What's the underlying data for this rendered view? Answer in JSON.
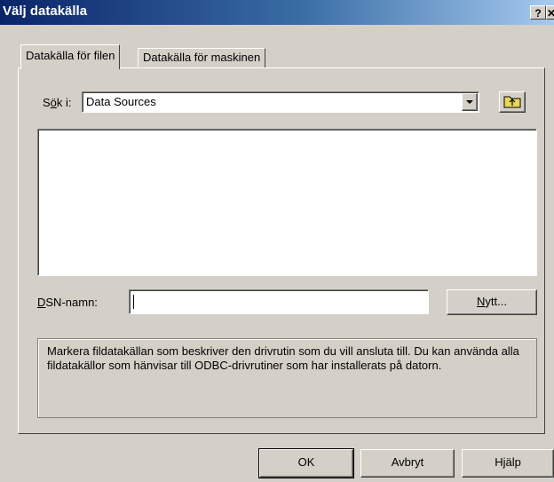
{
  "window": {
    "title": "Välj datakälla",
    "help_label": "?",
    "close_label": "✕"
  },
  "tabs": [
    {
      "label": "Datakälla för filen",
      "active": true
    },
    {
      "label": "Datakälla för maskinen",
      "active": false
    }
  ],
  "lookin": {
    "label_pre": "S",
    "label_ul": "ö",
    "label_post": "k i:",
    "value": "Data Sources"
  },
  "dsn": {
    "label_ul": "D",
    "label_post": "SN-namn:",
    "value": ""
  },
  "new_button": {
    "label_ul": "N",
    "label_post": "ytt..."
  },
  "info_text": "Markera fildatakällan som beskriver den drivrutin som du vill ansluta till. Du kan använda alla fildatakällor som hänvisar till ODBC-drivrutiner som har installerats på datorn.",
  "buttons": {
    "ok": "OK",
    "cancel": "Avbryt",
    "help": "Hjälp"
  },
  "icons": {
    "dropdown": "chevron-down-icon",
    "up_folder": "up-folder-icon"
  }
}
